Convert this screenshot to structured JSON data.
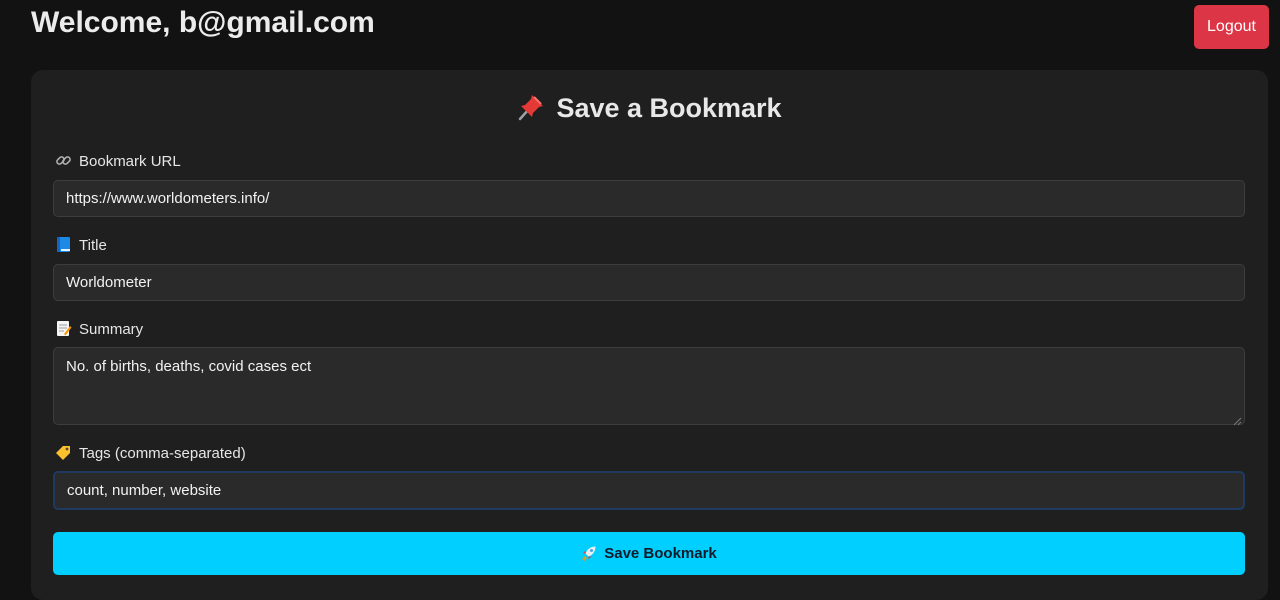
{
  "header": {
    "welcome_text": "Welcome, b@gmail.com",
    "logout_label": "Logout"
  },
  "form": {
    "title": "Save a Bookmark",
    "title_icon": "pushpin-icon",
    "url": {
      "label": "Bookmark URL",
      "icon": "link-icon",
      "value": "https://www.worldometers.info/"
    },
    "title_field": {
      "label": "Title",
      "icon": "book-icon",
      "value": "Worldometer"
    },
    "summary": {
      "label": "Summary",
      "icon": "memo-icon",
      "value": "No. of births, deaths, covid cases ect"
    },
    "tags": {
      "label": "Tags (comma-separated)",
      "icon": "tag-icon",
      "value": "count, number, website"
    },
    "submit_label": "Save Bookmark",
    "submit_icon": "rocket-icon"
  },
  "colors": {
    "background": "#121212",
    "card": "#1f1f1f",
    "logout": "#dc3545",
    "primary": "#00cfff"
  }
}
